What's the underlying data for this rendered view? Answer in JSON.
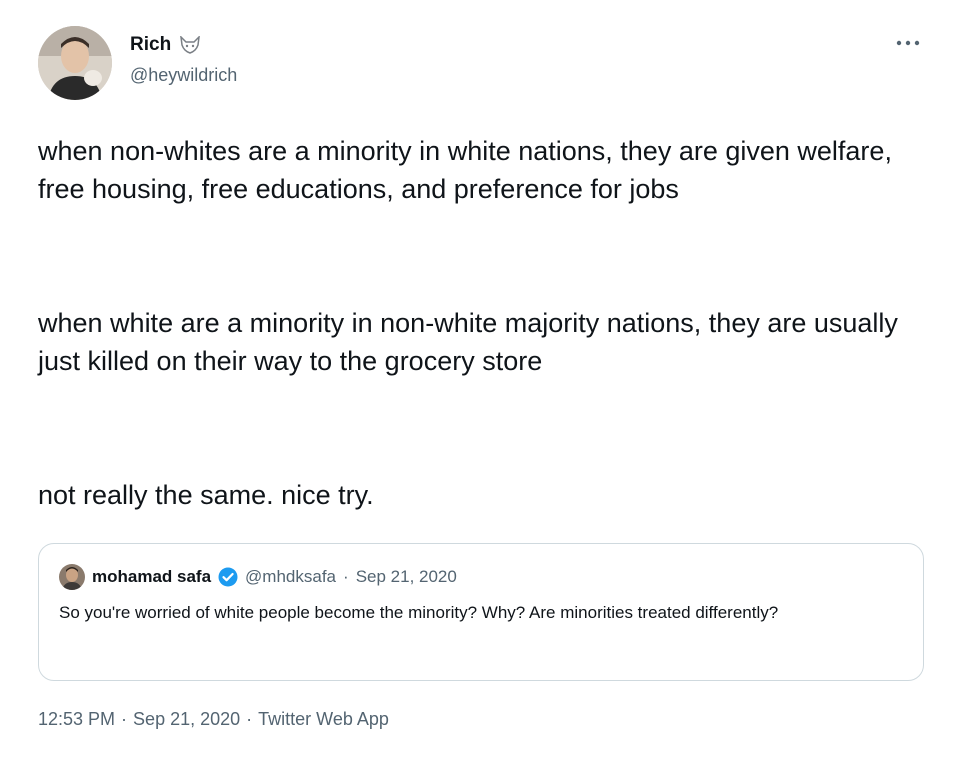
{
  "author": {
    "display_name": "Rich",
    "handle": "@heywildrich",
    "name_icon": "wolf-icon",
    "avatar_icon": "person-avatar"
  },
  "more_icon": "ellipsis-icon",
  "tweet": {
    "paragraphs": [
      "when non-whites are a minority in white nations, they are given welfare, free housing, free educations, and preference for jobs",
      "when white are a minority in non-white majority nations, they are usually just killed on their way to the grocery store",
      "not really the same. nice try."
    ]
  },
  "quoted_tweet": {
    "display_name": "mohamad safa",
    "verified_icon": "verified-badge-icon",
    "handle": "@mhdksafa",
    "separator": "·",
    "date": "Sep 21, 2020",
    "text": "So you're worried of white people become the minority? Why? Are minorities treated differently?"
  },
  "meta": {
    "time": "12:53 PM",
    "separator": "·",
    "date": "Sep 21, 2020",
    "source": "Twitter Web App"
  },
  "colors": {
    "text": "#0f1419",
    "secondary_text": "#536471",
    "border": "#cfd9de",
    "verified_blue": "#1d9bf0"
  }
}
